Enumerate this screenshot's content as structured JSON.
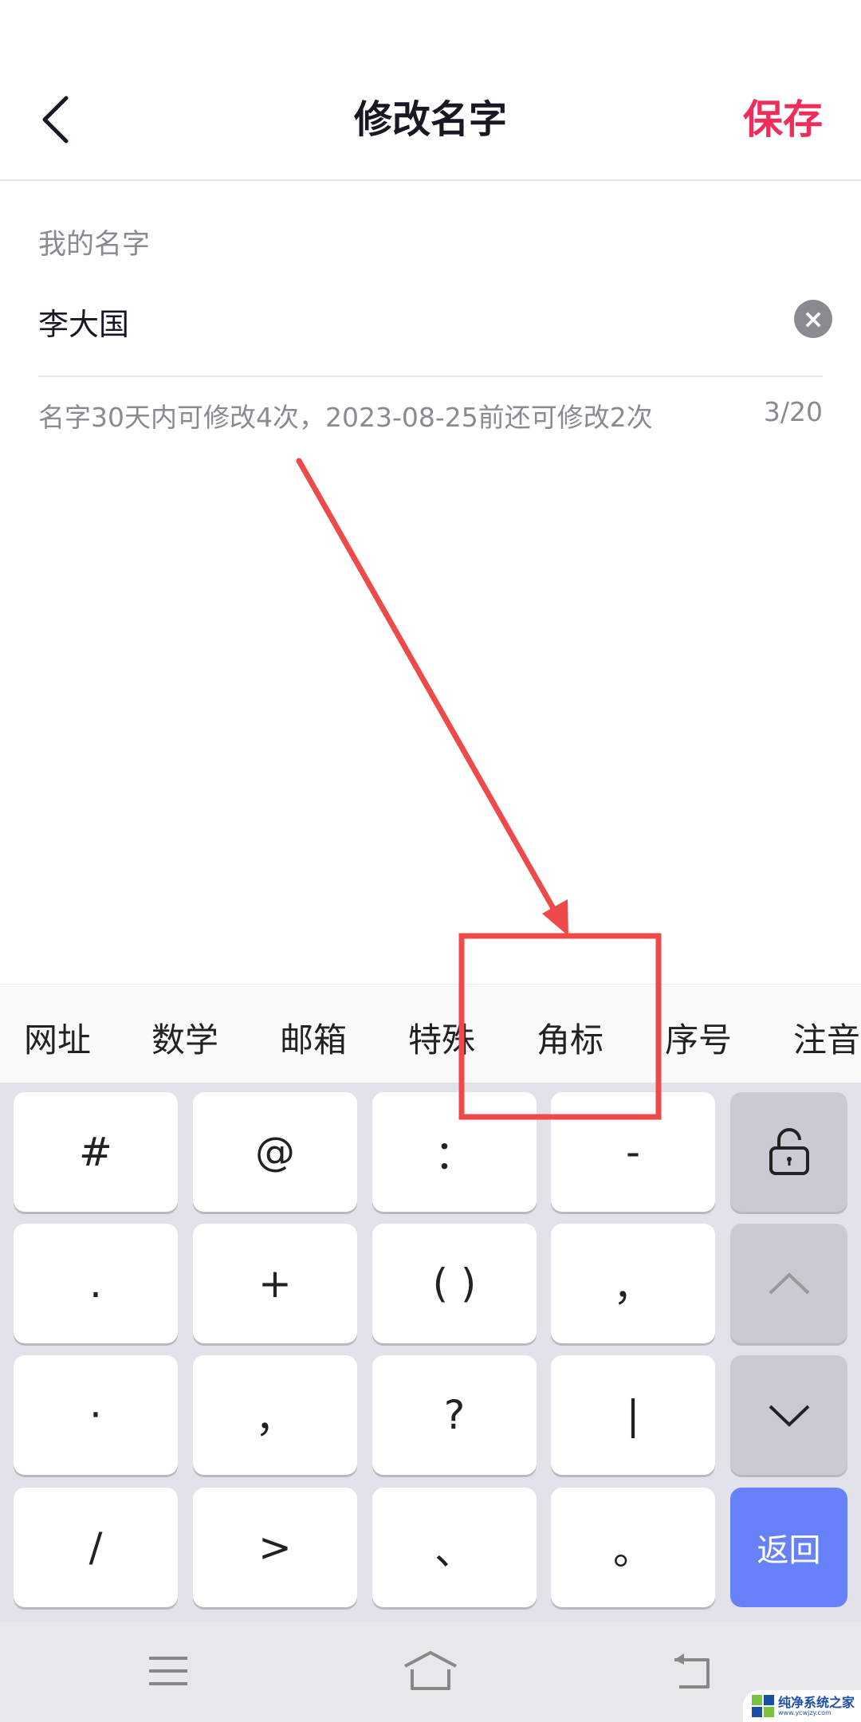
{
  "header": {
    "title": "修改名字",
    "save_label": "保存"
  },
  "form": {
    "label": "我的名字",
    "value": "李大国",
    "hint": "名字30天内可修改4次，2023-08-25前还可修改2次",
    "count": "3/20",
    "clear_icon": "×"
  },
  "keyboard": {
    "toolbar": [
      "网址",
      "数学",
      "邮箱",
      "特殊",
      "角标",
      "序号",
      "注音"
    ],
    "rows": [
      [
        "#",
        "@",
        "：",
        "-"
      ],
      [
        ".",
        "+",
        "( )",
        "，"
      ],
      [
        "·",
        "，",
        "?",
        "|"
      ],
      [
        "/",
        ">",
        "、",
        "。"
      ]
    ],
    "return_label": "返回",
    "side_icons": [
      "unlock-icon",
      "chevron-up-icon",
      "chevron-down-icon"
    ],
    "accent": "#6782f8"
  },
  "nav_icons": [
    "menu-icon",
    "home-icon",
    "back-icon"
  ],
  "watermark": {
    "title": "纯净系统之家",
    "url": "www.ycwjzy.com"
  },
  "colors": {
    "save": "#f02d5a",
    "annotation": "#ee4a4a",
    "keyboard_bg": "#e1e2ea"
  }
}
